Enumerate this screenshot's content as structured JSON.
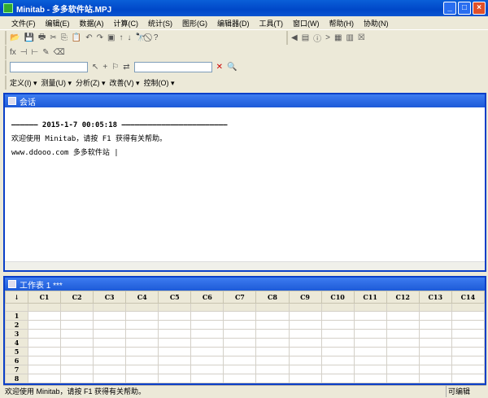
{
  "window": {
    "title": "Minitab - 多多软件站.MPJ",
    "min": "_",
    "max": "□",
    "close": "×"
  },
  "menu": [
    "文件(F)",
    "编辑(E)",
    "数据(A)",
    "计算(C)",
    "统计(S)",
    "图形(G)",
    "编辑器(D)",
    "工具(T)",
    "窗口(W)",
    "帮助(H)",
    "协助(N)"
  ],
  "sixsigma_menu": [
    "定义(I) ▾",
    "测量(U) ▾",
    "分析(Z) ▾",
    "改善(V) ▾",
    "控制(O) ▾"
  ],
  "session": {
    "title": "会话",
    "header": "——————    2015-1-7 00:05:18    ————————————————————————",
    "welcome": "欢迎使用 Minitab，请按 F1 获得有关帮助。",
    "line3": "www.ddooo.com  多多软件站   |"
  },
  "worksheet": {
    "title": "工作表 1 ***",
    "corner": "↓",
    "columns": [
      "C1",
      "C2",
      "C3",
      "C4",
      "C5",
      "C6",
      "C7",
      "C8",
      "C9",
      "C10",
      "C11",
      "C12",
      "C13",
      "C14"
    ],
    "rows": [
      "1",
      "2",
      "3",
      "4",
      "5",
      "6",
      "7",
      "8"
    ]
  },
  "status": {
    "text": "欢迎使用 Minitab，请按 F1 获得有关帮助。",
    "edit": "可编辑"
  }
}
